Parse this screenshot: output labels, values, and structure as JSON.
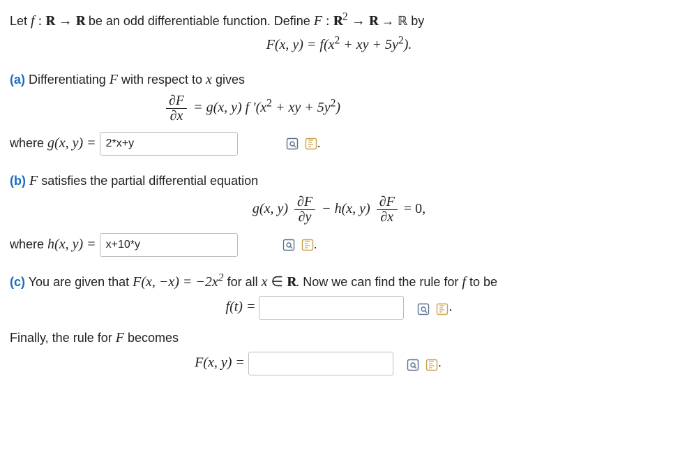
{
  "intro": {
    "pre_f": "Let ",
    "f_decl": "f : ℝ → ℝ",
    "mid1": " be an odd differentiable function. Define ",
    "F_decl": "F : ℝ",
    "F_sup": "2",
    "mid2": " → ℝ by"
  },
  "eqF_def": {
    "lhs": "F(x, y) = f(x",
    "sup1": "2",
    "mid": " + xy + 5y",
    "sup2": "2",
    "rhs": ")."
  },
  "partA": {
    "label": "(a)",
    "text_before": " Differentiating ",
    "Fsym": "F",
    "text_after": " with respect to ",
    "xsym": "x",
    "text_end": " gives",
    "frac_num": "∂F",
    "frac_den": "∂x",
    "rhs_pre": " = g(x, y) f ′(x",
    "rhs_sup1": "2",
    "rhs_mid": " + xy + 5y",
    "rhs_sup2": "2",
    "rhs_post": ")",
    "where": "where ",
    "gxy": "g(x, y) = ",
    "input_value": "2*x+y",
    "period": "."
  },
  "partB": {
    "label": "(b)",
    "Fsym": "F",
    "text": " satisfies the partial differential equation",
    "eq_g": "g(x, y)",
    "frac1_num": "∂F",
    "frac1_den": "∂y",
    "minus": " − h(x, y)",
    "frac2_num": "∂F",
    "frac2_den": "∂x",
    "eqend": " = 0,",
    "where": "where  ",
    "hxy": "h(x, y) = ",
    "input_value": "x+10*y",
    "period": "."
  },
  "partC": {
    "label": "(c)",
    "lead": "  You are given that  ",
    "Fxmx": "F(x, −x) = −2x",
    "sup": "2",
    "mid": "  for all ",
    "xin": "x ∈ ℝ",
    "tail1": ". Now we can find the rule for ",
    "fsym": "f",
    "tail2": "   to be",
    "ft_lhs": "f(t) = ",
    "ft_value": "",
    "period1": ".",
    "finally_pre": "Finally, the rule for  ",
    "Fsym": "F",
    "finally_post": "  becomes",
    "Fxy_lhs": "F(x, y) = ",
    "Fxy_value": "",
    "period2": "."
  }
}
